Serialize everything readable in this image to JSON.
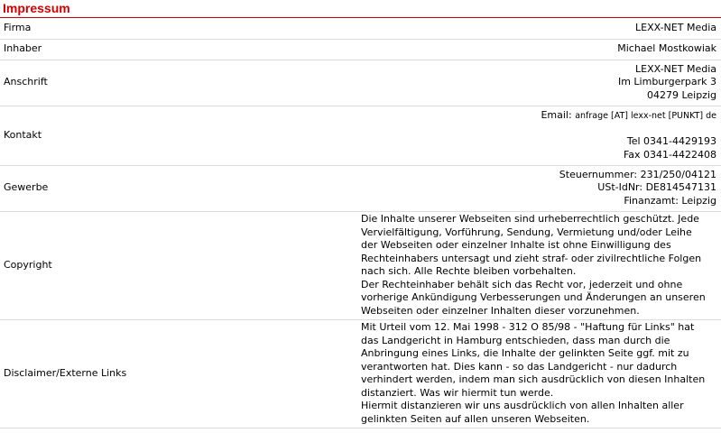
{
  "page": {
    "title": "Impressum"
  },
  "rows": {
    "firma": {
      "label": "Firma",
      "value": "LEXX-NET Media"
    },
    "inhaber": {
      "label": "Inhaber",
      "value": "Michael Mostkowiak"
    },
    "anschrift": {
      "label": "Anschrift",
      "lines": [
        "LEXX-NET Media",
        "Im Limburgerpark 3",
        "04279 Leipzig"
      ]
    },
    "kontakt": {
      "label": "Kontakt",
      "email_label": "Email:",
      "email_value": "anfrage [AT] lexx-net [PUNKT] de",
      "tel": "Tel 0341-4429193",
      "fax": "Fax 0341-4422408"
    },
    "gewerbe": {
      "label": "Gewerbe",
      "lines": [
        "Steuernummer: 231/250/04121",
        "USt-IdNr: DE814547131",
        "Finanzamt: Leipzig"
      ]
    },
    "copyright": {
      "label": "Copyright",
      "lines": [
        "Die Inhalte unserer Webseiten sind urheberrechtlich geschützt. Jede",
        "Vervielfältigung, Vorführung, Sendung, Vermietung und/oder Leihe",
        "der Webseiten oder einzelner Inhalte ist ohne Einwilligung des",
        "Rechteinhabers untersagt und zieht straf- oder zivilrechtliche Folgen",
        "nach sich. Alle Rechte bleiben vorbehalten.",
        "Der Rechteinhaber behält sich das Recht vor, jederzeit und ohne",
        "vorherige Ankündigung Verbesserungen und Änderungen an unseren",
        "Webseiten oder einzelner Inhalten dieser vorzunehmen."
      ]
    },
    "disclaimer": {
      "label": "Disclaimer/Externe Links",
      "lines": [
        "Mit Urteil vom 12. Mai 1998 - 312 O 85/98 - \"Haftung für Links\" hat",
        "das Landgericht in Hamburg entschieden, dass man durch die",
        "Anbringung eines Links, die Inhalte der gelinkten Seite ggf. mit zu",
        "verantworten hat. Dies kann - so das Landgericht - nur dadurch",
        "verhindert werden, indem man sich ausdrücklich von diesen Inhalten",
        "distanziert. Was wir hiermit tun werde.",
        "Hiermit distanzieren wir uns ausdrücklich von allen Inhalten aller",
        "gelinkten Seiten auf allen unseren Webseiten."
      ]
    }
  }
}
